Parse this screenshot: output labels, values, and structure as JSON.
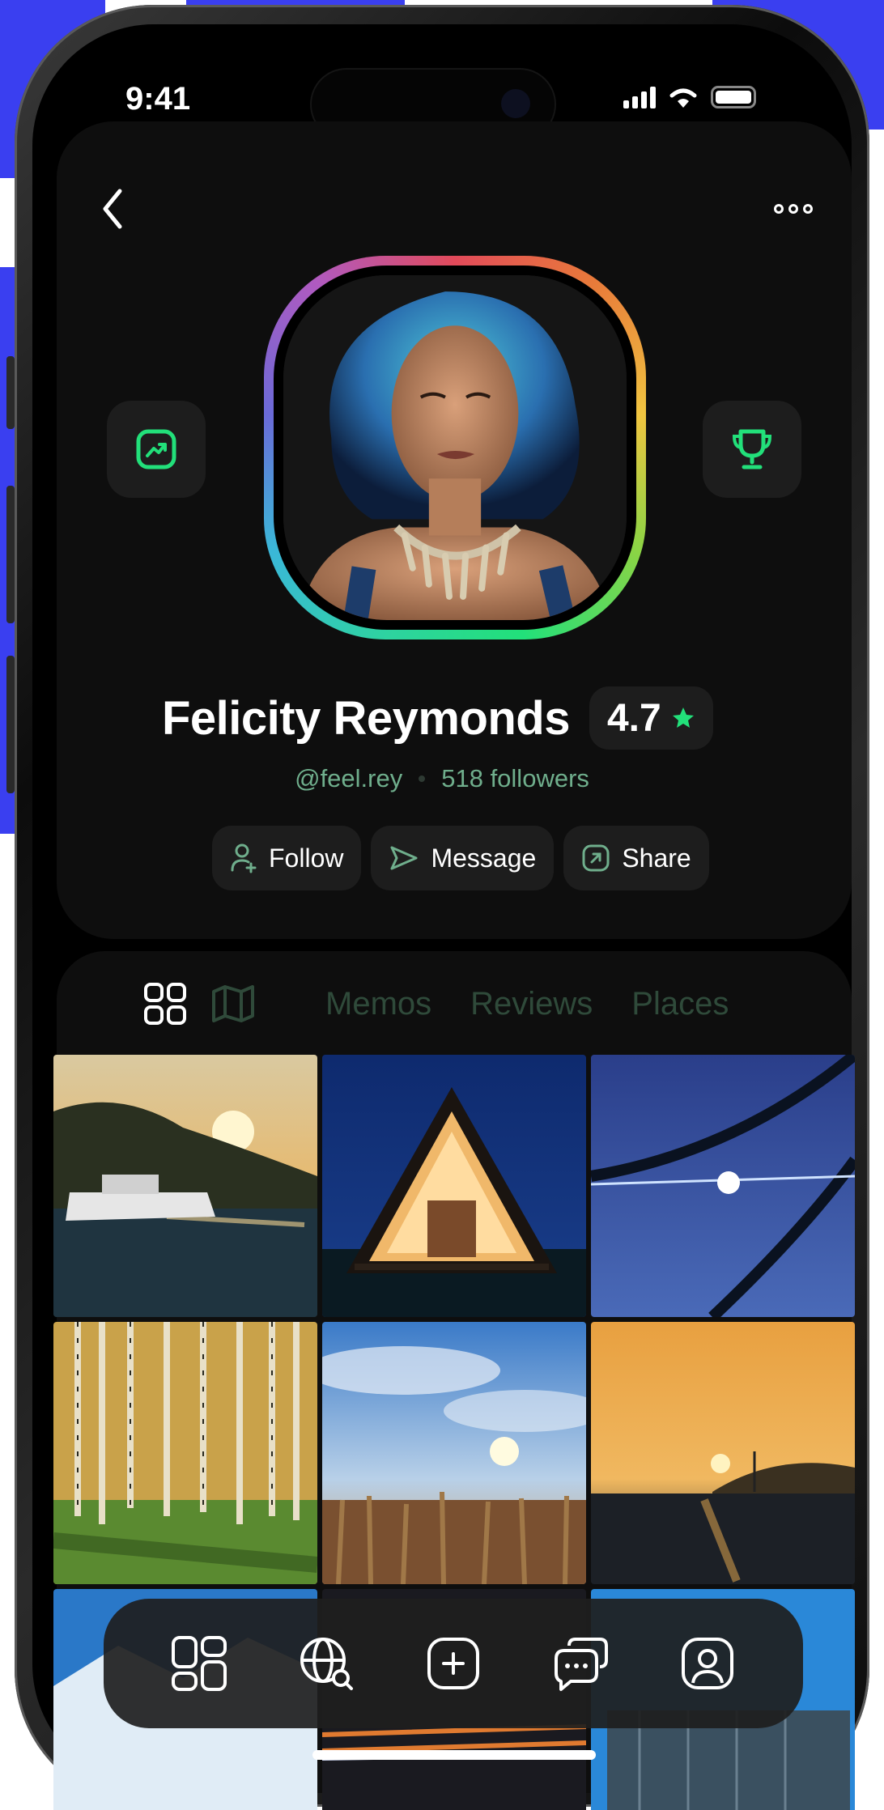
{
  "status_bar": {
    "time": "9:41"
  },
  "header": {
    "back_icon": "chevron-left-icon",
    "more_icon": "more-dots-icon"
  },
  "profile": {
    "name": "Felicity Reymonds",
    "rating": "4.7",
    "handle": "@feel.rey",
    "followers": "518 followers",
    "left_tile_icon": "trending-up-icon",
    "right_tile_icon": "trophy-icon",
    "accent_color": "#22e07a"
  },
  "actions": [
    {
      "label": "Follow",
      "icon": "user-plus-icon"
    },
    {
      "label": "Message",
      "icon": "send-icon"
    },
    {
      "label": "Share",
      "icon": "share-icon"
    }
  ],
  "tabs": {
    "icons": [
      "grid-icon",
      "map-icon"
    ],
    "labels": [
      "Memos",
      "Reviews",
      "Places"
    ]
  },
  "photos": [
    "sunset-yacht",
    "a-frame-cabin",
    "palm-sun",
    "birch-forest",
    "cloudy-sky-field",
    "sunset-sea-sailboat",
    "snowy-mountains",
    "night-highway",
    "city-glass"
  ],
  "bottom_nav": [
    "grid-icon",
    "globe-search-icon",
    "add-icon",
    "chat-icon",
    "profile-icon"
  ]
}
